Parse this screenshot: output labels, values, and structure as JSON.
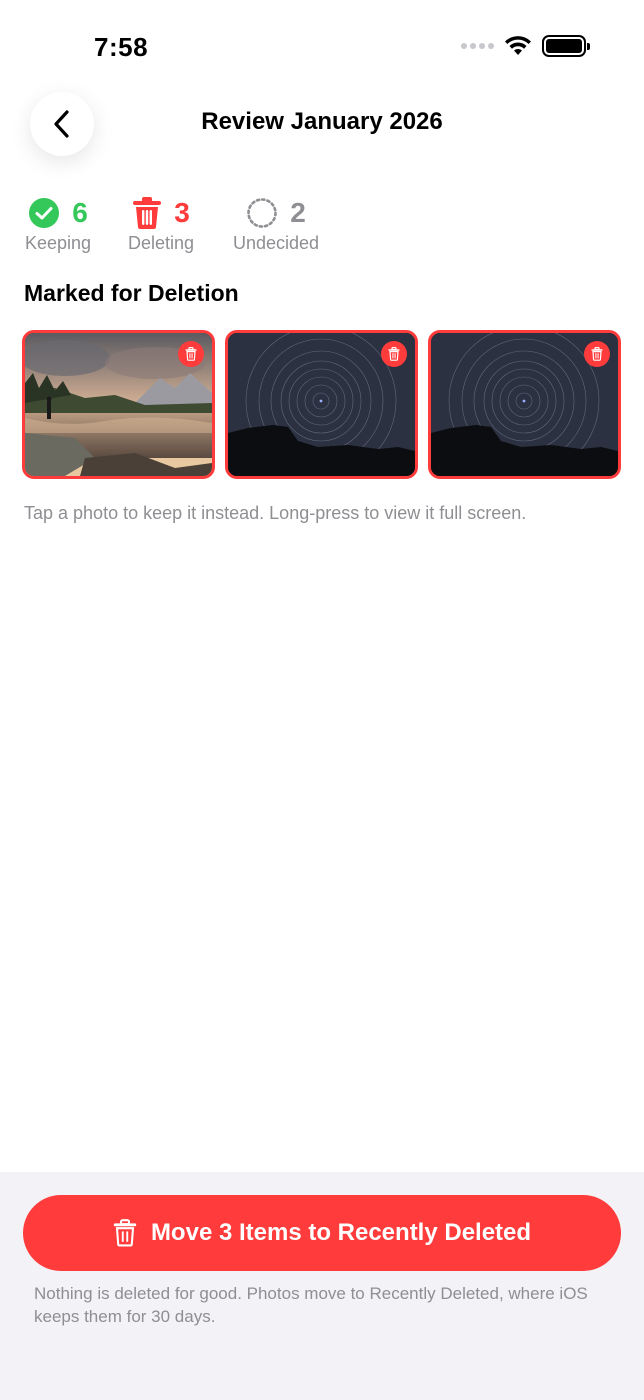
{
  "status_bar": {
    "time": "7:58"
  },
  "header": {
    "title": "Review January 2026"
  },
  "stats": {
    "keeping": {
      "count": "6",
      "label": "Keeping",
      "color": "#34c759"
    },
    "deleting": {
      "count": "3",
      "label": "Deleting",
      "color": "#ff3b3b"
    },
    "undecided": {
      "count": "2",
      "label": "Undecided",
      "color": "#8e8e93"
    }
  },
  "section": {
    "title": "Marked for Deletion"
  },
  "photos": [
    {
      "subject": "mountain lake at sunset"
    },
    {
      "subject": "star trails over silhouette"
    },
    {
      "subject": "star trails over silhouette"
    }
  ],
  "hint": "Tap a photo to keep it instead. Long-press to view it full screen.",
  "footer": {
    "button_label": "Move 3 Items to Recently Deleted",
    "footnote": "Nothing is deleted for good. Photos move to Recently Deleted, where iOS keeps them for 30 days."
  },
  "colors": {
    "accent_red": "#ff3b3b",
    "keep_green": "#34c759",
    "secondary_text": "#8e8e93"
  }
}
